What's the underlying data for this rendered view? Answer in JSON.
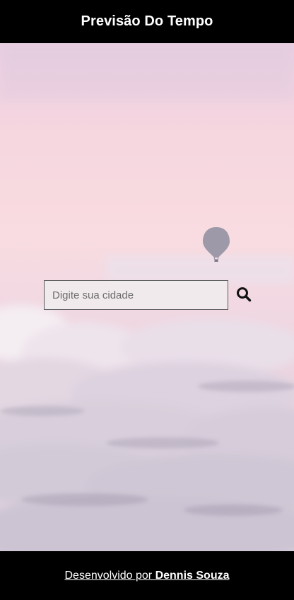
{
  "header": {
    "title": "Previsão Do Tempo"
  },
  "search": {
    "placeholder": "Digite sua cidade",
    "button_icon": "search-icon"
  },
  "background": {
    "description_icon": "hot-air-balloon-icon"
  },
  "footer": {
    "prefix": "Desenvolvido por ",
    "author": "Dennis Souza"
  },
  "colors": {
    "bar": "#000000",
    "text": "#ffffff"
  }
}
